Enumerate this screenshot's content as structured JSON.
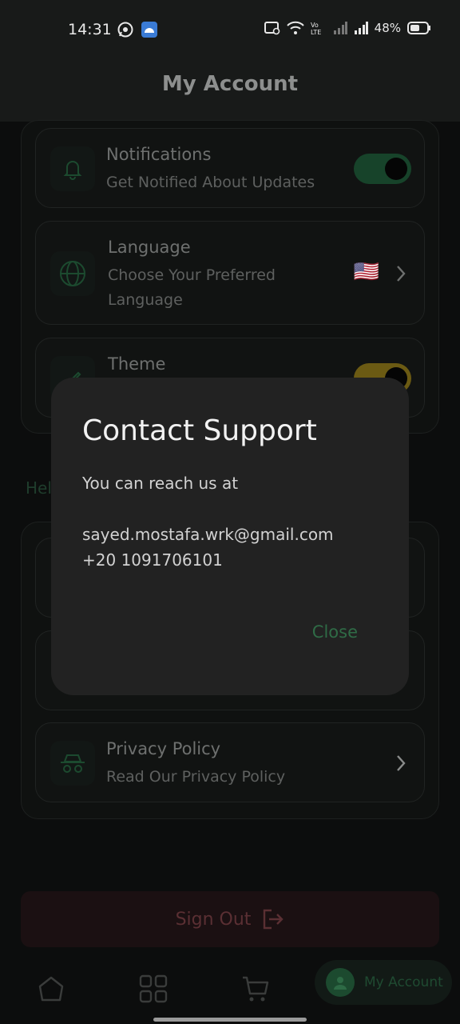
{
  "status_bar": {
    "time": "14:31",
    "battery": "48%",
    "icons": [
      "whatsapp-icon",
      "android-icon",
      "cast-icon",
      "wifi-icon",
      "volte-icon",
      "signal-icon",
      "signal-icon",
      "battery-icon"
    ]
  },
  "header": {
    "title": "My Account"
  },
  "settings": {
    "items": [
      {
        "title": "Notifications",
        "subtitle": "Get Notified About Updates",
        "icon": "bell-icon",
        "control": "toggle"
      },
      {
        "title": "Language",
        "subtitle_line1": "Choose Your Preferred",
        "subtitle_line2": "Language",
        "icon": "globe-icon",
        "flag": "🇺🇸",
        "control": "chevron"
      },
      {
        "title": "Theme",
        "icon": "paint-brush-icon",
        "control": "toggle"
      }
    ]
  },
  "help": {
    "label": "Hel",
    "items": [
      {
        "title": "Privacy Policy",
        "subtitle": "Read Our Privacy Policy",
        "icon": "incognito-icon",
        "control": "chevron"
      }
    ]
  },
  "sign_out": {
    "label": "Sign Out",
    "icon": "logout-icon"
  },
  "bottom_nav": {
    "items": [
      "home-icon",
      "grid-icon",
      "cart-icon"
    ],
    "active_label": "My Account"
  },
  "dialog": {
    "title": "Contact Support",
    "intro": "You can reach us at",
    "email": "sayed.mostafa.wrk@gmail.com",
    "phone": "+20 1091706101",
    "close_label": "Close"
  },
  "colors": {
    "accent": "#2f6b46",
    "toggle_on": "#17432a",
    "toggle_theme": "#6b5a13",
    "danger": "#5a2f33"
  }
}
